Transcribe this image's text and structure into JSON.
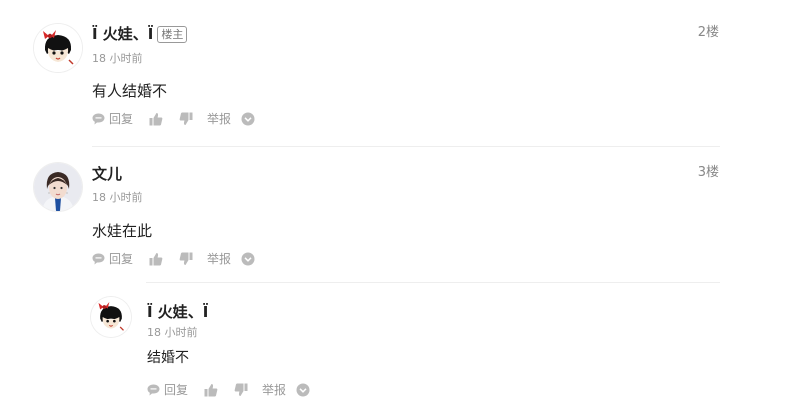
{
  "comments": [
    {
      "username": "Ï 火娃、Ï",
      "badge": "楼主",
      "time": "18 小时前",
      "floor": "2楼",
      "content": "有人结婚不",
      "avatar_icon": "cartoon-girl-red-bow-avatar",
      "actions": {
        "reply": "回复",
        "report": "举报"
      }
    },
    {
      "username": "文儿",
      "time": "18 小时前",
      "floor": "3楼",
      "content": "水娃在此",
      "avatar_icon": "photo-girl-avatar",
      "actions": {
        "reply": "回复",
        "report": "举报"
      }
    }
  ],
  "reply": {
    "username": "Ï 火娃、Ï",
    "time": "18 小时前",
    "content": "结婚不",
    "avatar_icon": "cartoon-girl-red-bow-avatar",
    "actions": {
      "reply": "回复",
      "report": "举报"
    }
  },
  "colors": {
    "text_primary": "#222222",
    "text_secondary": "#999999",
    "divider": "#eeeeee",
    "icon_gray": "#bbbbbb"
  }
}
